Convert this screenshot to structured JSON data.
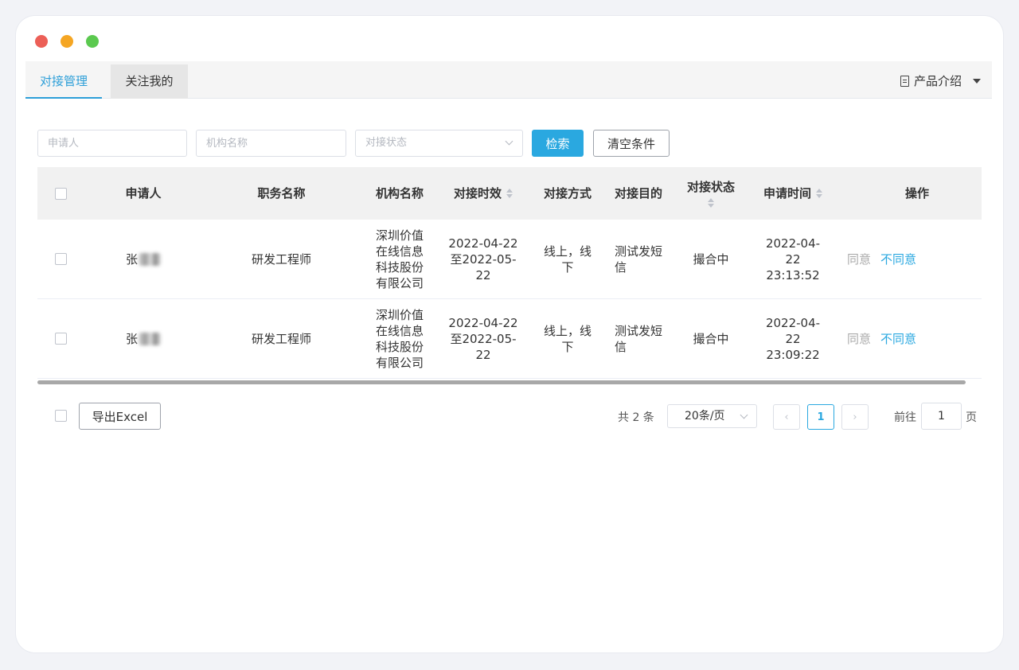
{
  "tabs": [
    {
      "label": "对接管理",
      "active": true
    },
    {
      "label": "关注我的",
      "active": false
    }
  ],
  "header": {
    "product_intro": "产品介绍"
  },
  "filters": {
    "applicant_placeholder": "申请人",
    "org_placeholder": "机构名称",
    "status_placeholder": "对接状态",
    "search_label": "检索",
    "clear_label": "清空条件"
  },
  "table": {
    "columns": {
      "applicant": "申请人",
      "position": "职务名称",
      "org": "机构名称",
      "period": "对接时效",
      "method": "对接方式",
      "purpose": "对接目的",
      "status": "对接状态",
      "apply_time": "申请时间",
      "actions": "操作"
    },
    "rows": [
      {
        "applicant": "张",
        "position": "研发工程师",
        "org": "深圳价值在线信息科技股份有限公司",
        "period": "2022-04-22至2022-05-22",
        "method": "线上，线下",
        "purpose": "测试发短信",
        "status": "撮合中",
        "apply_time": "2022-04-22 23:13:52",
        "agree": "同意",
        "disagree": "不同意"
      },
      {
        "applicant": "张",
        "position": "研发工程师",
        "org": "深圳价值在线信息科技股份有限公司",
        "period": "2022-04-22至2022-05-22",
        "method": "线上，线下",
        "purpose": "测试发短信",
        "status": "撮合中",
        "apply_time": "2022-04-22 23:09:22",
        "agree": "同意",
        "disagree": "不同意"
      }
    ]
  },
  "footer": {
    "export_label": "导出Excel",
    "total_text": "共 2 条",
    "page_size": "20条/页",
    "current_page": "1",
    "goto_prefix": "前往",
    "goto_value": "1",
    "goto_suffix": "页"
  },
  "icons": {
    "product_intro": "document-icon",
    "dropdown": "caret-down-icon",
    "prev": "chevron-left-icon",
    "next": "chevron-right-icon"
  },
  "colors": {
    "accent": "#2aa8e0",
    "muted_link": "#aaaaaa"
  }
}
